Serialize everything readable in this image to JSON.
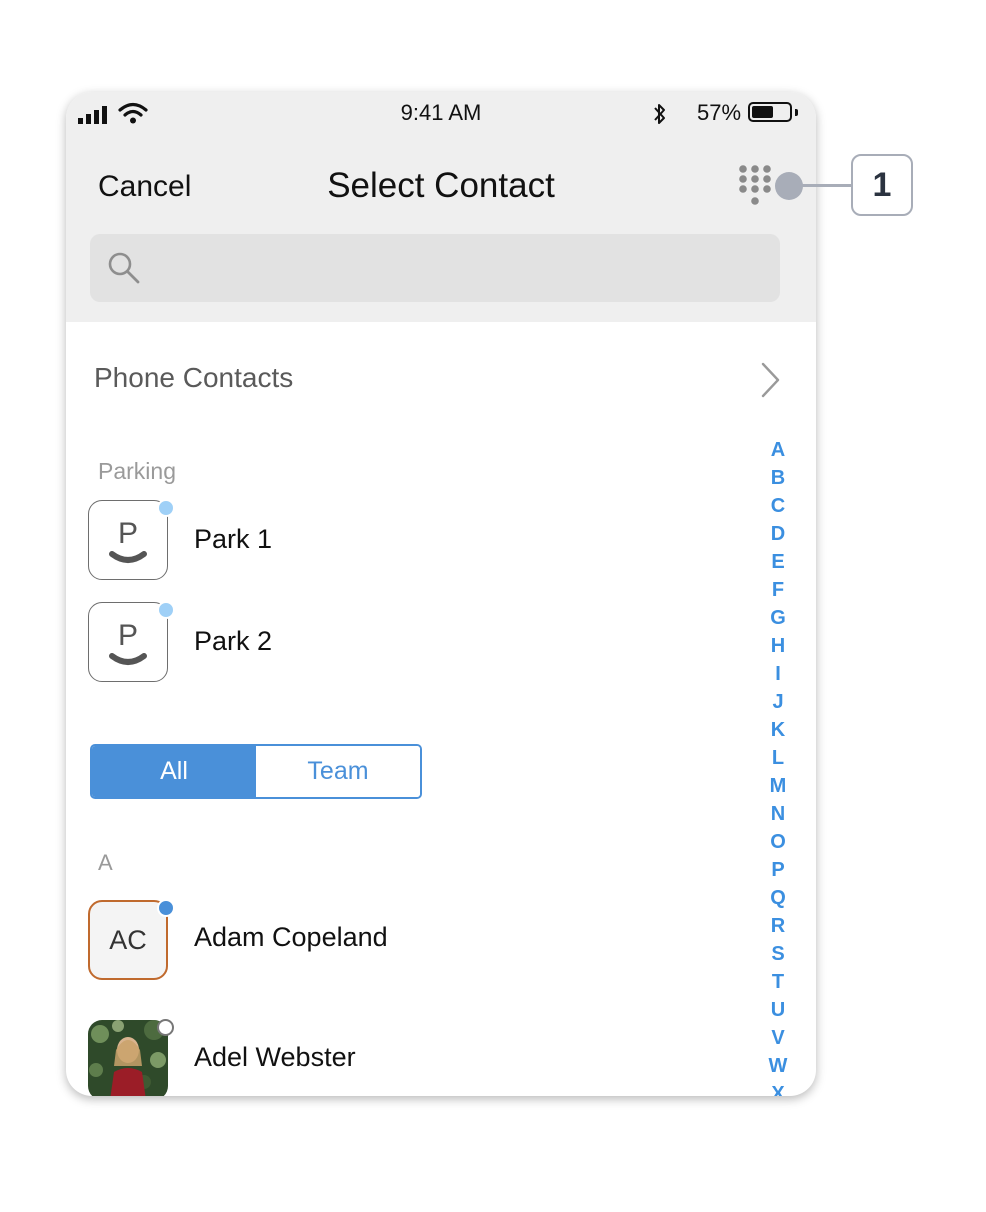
{
  "status_bar": {
    "time": "9:41 AM",
    "battery_percent": "57%",
    "battery_level": 0.57
  },
  "header": {
    "cancel_label": "Cancel",
    "title": "Select Contact"
  },
  "search": {
    "placeholder": ""
  },
  "phone_contacts": {
    "label": "Phone Contacts"
  },
  "parking": {
    "header": "Parking",
    "items": [
      {
        "avatar_letter": "P",
        "name": "Park 1"
      },
      {
        "avatar_letter": "P",
        "name": "Park 2"
      }
    ]
  },
  "filter": {
    "tabs": [
      {
        "label": "All",
        "active": true
      },
      {
        "label": "Team",
        "active": false
      }
    ]
  },
  "contacts": {
    "section_header": "A",
    "items": [
      {
        "initials": "AC",
        "name": "Adam Copeland",
        "presence": "available"
      },
      {
        "initials": "",
        "name": "Adel Webster",
        "presence": "offline"
      }
    ]
  },
  "alpha_index": [
    "A",
    "B",
    "C",
    "D",
    "E",
    "F",
    "G",
    "H",
    "I",
    "J",
    "K",
    "L",
    "M",
    "N",
    "O",
    "P",
    "Q",
    "R",
    "S",
    "T",
    "U",
    "V",
    "W",
    "X"
  ],
  "callout": {
    "number": "1"
  },
  "colors": {
    "accent": "#4a90d9",
    "index_blue": "#3b8fe0",
    "header_bg": "#efefef",
    "initials_border": "#c06a2e"
  }
}
